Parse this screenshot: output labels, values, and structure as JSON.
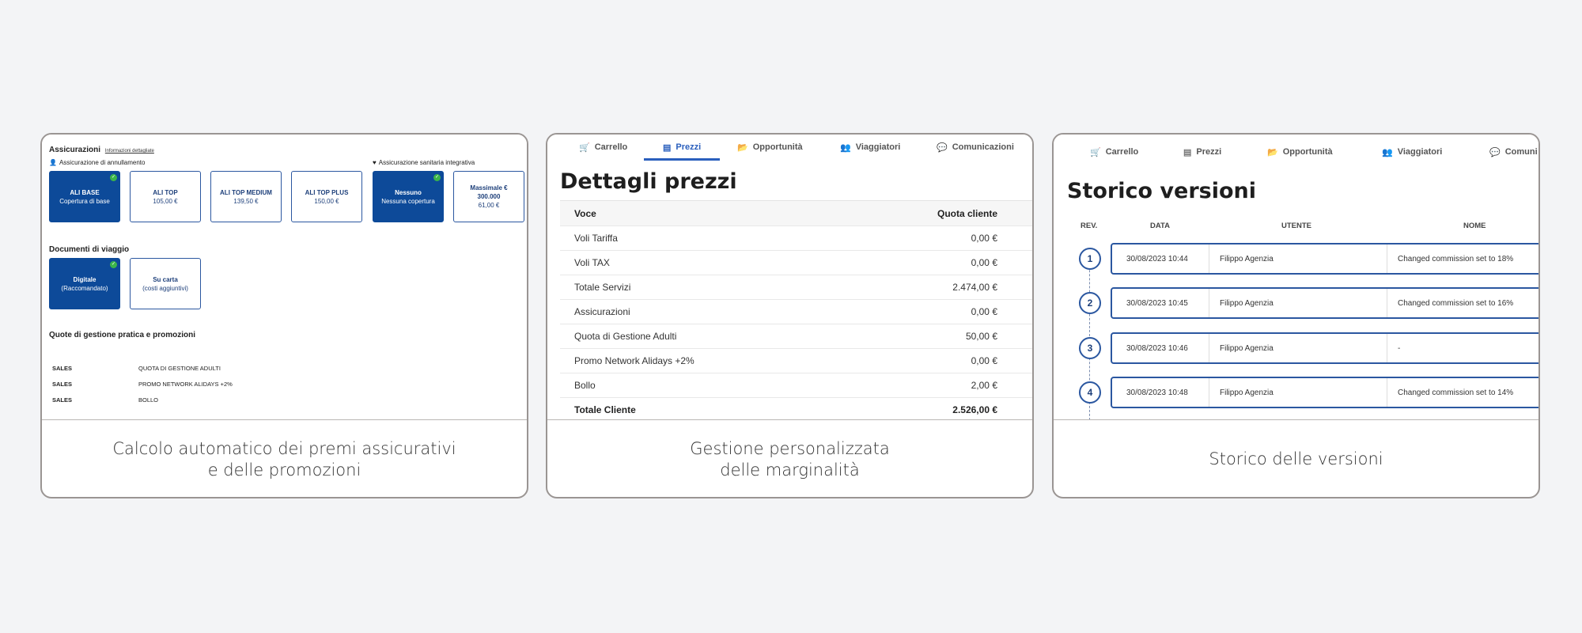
{
  "card1": {
    "title": "Assicurazioni",
    "title_link": "Informazioni dettagliate",
    "cancel_label": "Assicurazione di annullamento",
    "health_label": "Assicurazione sanitaria integrativa",
    "insurances": [
      {
        "name": "ALI BASE",
        "price": "Copertura di base",
        "selected": true
      },
      {
        "name": "ALI TOP",
        "price": "105,00 €",
        "selected": false
      },
      {
        "name": "ALI TOP MEDIUM",
        "price": "139,50 €",
        "selected": false
      },
      {
        "name": "ALI TOP PLUS",
        "price": "150,00 €",
        "selected": false
      },
      {
        "name": "Nessuno",
        "price": "Nessuna copertura",
        "selected": true
      },
      {
        "name": "Massimale € 300.000",
        "price": "61,00 €",
        "selected": false
      }
    ],
    "docs_title": "Documenti di viaggio",
    "docs": [
      {
        "name": "Digitale",
        "price": "(Raccomandato)",
        "selected": true
      },
      {
        "name": "Su carta",
        "price": "(costi aggiuntivi)",
        "selected": false
      }
    ],
    "fees_title": "Quote di gestione pratica e promozioni",
    "fees": [
      {
        "type": "SALES",
        "label": "QUOTA DI GESTIONE ADULTI"
      },
      {
        "type": "SALES",
        "label": "PROMO NETWORK ALIDAYS +2%"
      },
      {
        "type": "SALES",
        "label": "BOLLO"
      }
    ],
    "caption_line1": "Calcolo automatico dei premi assicurativi",
    "caption_line2": "e delle promozioni"
  },
  "card2": {
    "tabs": [
      "Carrello",
      "Prezzi",
      "Opportunità",
      "Viaggiatori",
      "Comunicazioni"
    ],
    "active_tab": "Prezzi",
    "title": "Dettagli prezzi",
    "col_voce": "Voce",
    "col_quota": "Quota cliente",
    "rows": [
      {
        "voce": "Voli Tariffa",
        "quota": "0,00 €"
      },
      {
        "voce": "Voli TAX",
        "quota": "0,00 €"
      },
      {
        "voce": "Totale Servizi",
        "quota": "2.474,00 €"
      },
      {
        "voce": "Assicurazioni",
        "quota": "0,00 €"
      },
      {
        "voce": "Quota di Gestione Adulti",
        "quota": "50,00 €"
      },
      {
        "voce": "Promo Network Alidays +2%",
        "quota": "0,00 €"
      },
      {
        "voce": "Bollo",
        "quota": "2,00 €"
      },
      {
        "voce": "Totale Cliente",
        "quota": "2.526,00 €"
      }
    ],
    "caption_line1": "Gestione personalizzata",
    "caption_line2": "delle marginalità"
  },
  "card3": {
    "tabs": [
      "Carrello",
      "Prezzi",
      "Opportunità",
      "Viaggiatori",
      "Comuni"
    ],
    "title": "Storico versioni",
    "col_rev": "REV.",
    "col_data": "DATA",
    "col_utente": "UTENTE",
    "col_nome": "NOME",
    "versions": [
      {
        "rev": "1",
        "data": "30/08/2023 10:44",
        "utente": "Filippo Agenzia",
        "nome": "Changed commission set to 18%"
      },
      {
        "rev": "2",
        "data": "30/08/2023 10:45",
        "utente": "Filippo Agenzia",
        "nome": "Changed commission set to 16%"
      },
      {
        "rev": "3",
        "data": "30/08/2023 10:46",
        "utente": "Filippo Agenzia",
        "nome": "-"
      },
      {
        "rev": "4",
        "data": "30/08/2023 10:48",
        "utente": "Filippo Agenzia",
        "nome": "Changed commission set to 14%"
      }
    ],
    "caption": "Storico delle versioni"
  },
  "colors": {
    "accent": "#2a5fbd",
    "selected_fill": "#0d4a99",
    "check": "#3bb54a"
  }
}
